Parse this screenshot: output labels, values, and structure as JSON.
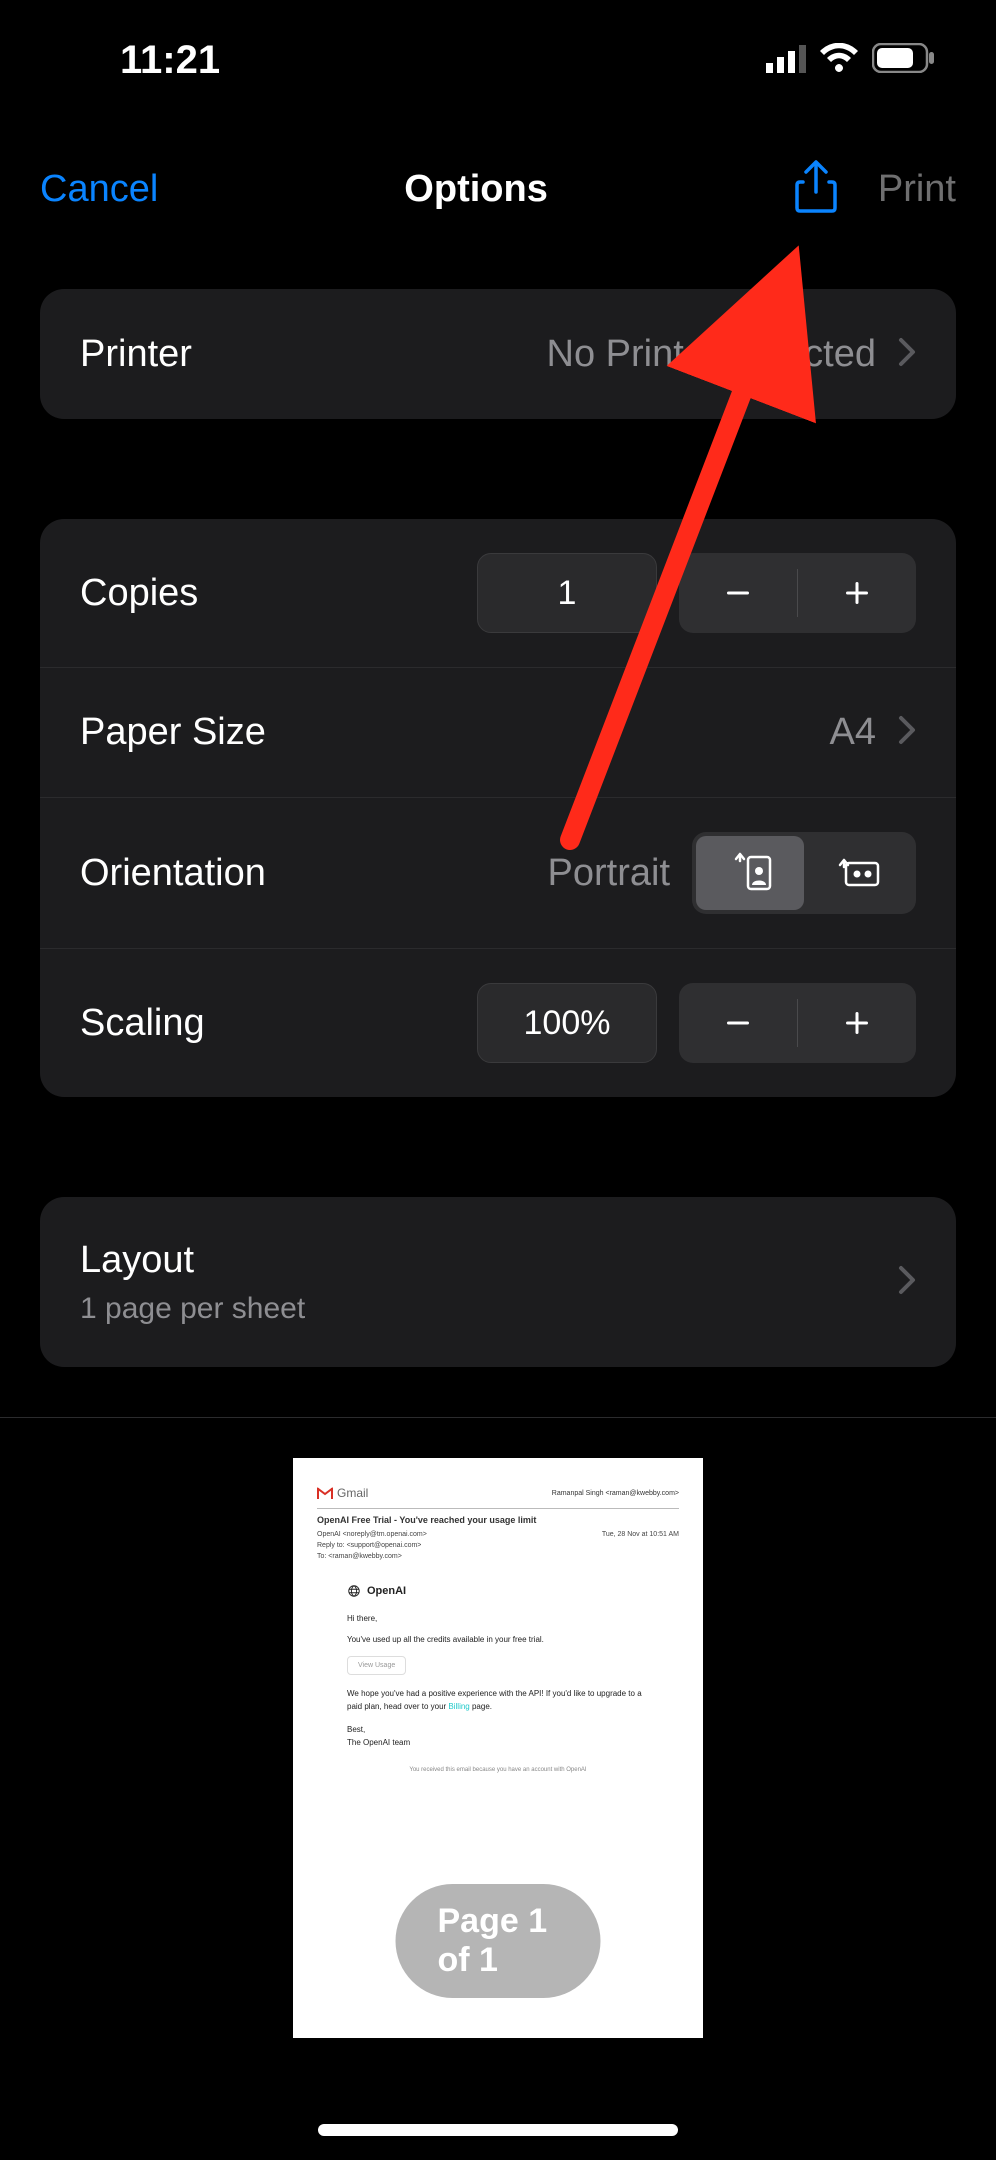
{
  "status": {
    "time": "11:21"
  },
  "nav": {
    "cancel": "Cancel",
    "title": "Options",
    "print": "Print"
  },
  "printer": {
    "label": "Printer",
    "value": "No Printer Selected"
  },
  "copies": {
    "label": "Copies",
    "value": "1"
  },
  "paperSize": {
    "label": "Paper Size",
    "value": "A4"
  },
  "orientation": {
    "label": "Orientation",
    "value": "Portrait"
  },
  "scaling": {
    "label": "Scaling",
    "value": "100%"
  },
  "layout": {
    "label": "Layout",
    "sub": "1 page per sheet"
  },
  "page_badge": "Page 1 of 1",
  "preview": {
    "gmail": "Gmail",
    "from_name": "Ramanpal Singh <raman@kwebby.com>",
    "subject": "OpenAI Free Trial - You've reached your usage limit",
    "meta_from": "OpenAI <noreply@tm.openai.com>",
    "meta_reply": "Reply to: <support@openai.com>",
    "meta_to": "To: <raman@kwebby.com>",
    "meta_date": "Tue, 28 Nov at 10:51 AM",
    "oa": "OpenAI",
    "hi": "Hi there,",
    "line1": "You've used up all the credits available in your free trial.",
    "view_usage": "View Usage",
    "line2a": "We hope you've had a positive experience with the API! If you'd like to upgrade to a paid plan, head over to your ",
    "line2link": "Billing",
    "line2b": " page.",
    "best": "Best,",
    "team": "The OpenAI team",
    "footer": "You received this email because you have an account with OpenAI"
  }
}
